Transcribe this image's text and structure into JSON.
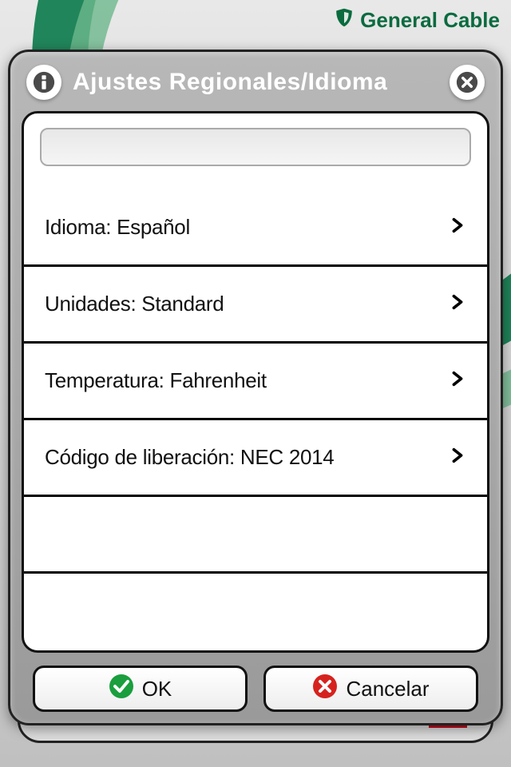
{
  "brand": {
    "name": "General Cable"
  },
  "modal": {
    "title": "Ajustes Regionales/Idioma",
    "options": [
      {
        "label": "Idioma: Español"
      },
      {
        "label": "Unidades: Standard"
      },
      {
        "label": "Temperatura: Fahrenheit"
      },
      {
        "label": "Código de liberación: NEC 2014"
      }
    ],
    "ok": "OK",
    "cancel": "Cancelar"
  },
  "behind": {
    "footer_text": "Ajustes Regionales/Idioma"
  }
}
